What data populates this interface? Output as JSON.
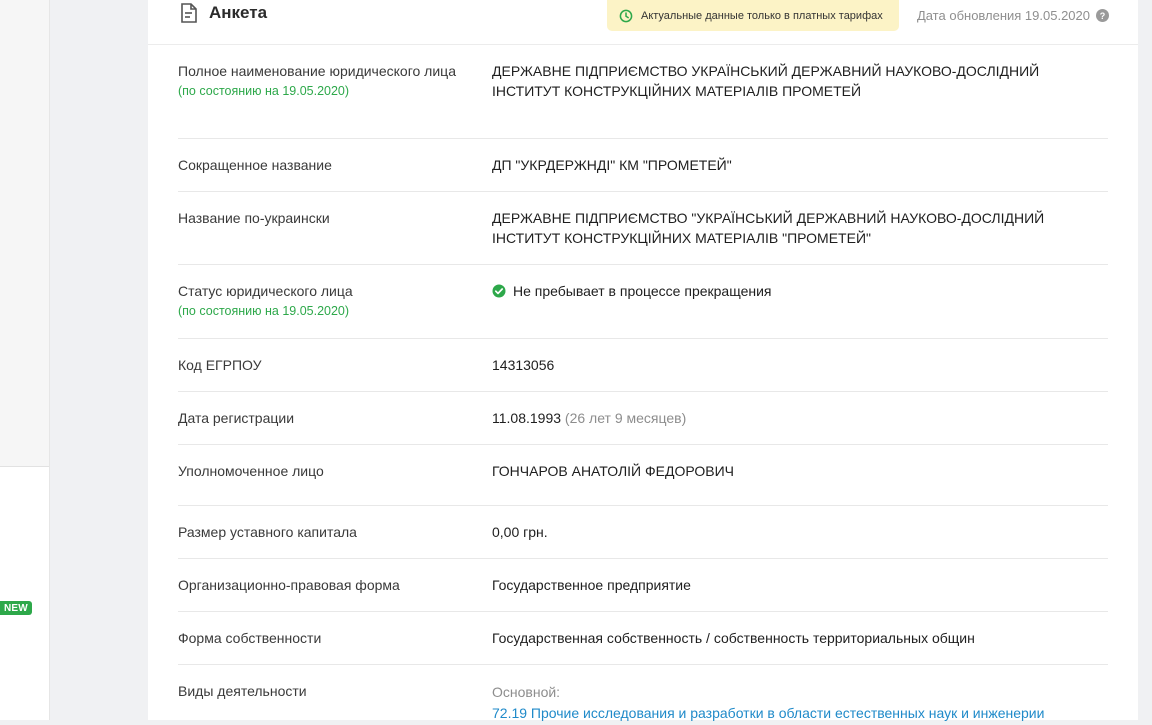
{
  "card": {
    "title": "Анкета",
    "banner_text": "Актуальные данные только в платных тарифах",
    "update_date": "Дата обновления 19.05.2020"
  },
  "sidebar": {
    "new_badge": "NEW"
  },
  "rows": [
    {
      "label": "Полное наименование юридического лица",
      "sublabel": "(по состоянию на 19.05.2020)",
      "value": "ДЕРЖАВНЕ ПІДПРИЄМСТВО УКРАЇНСЬКИЙ ДЕРЖАВНИЙ НАУКОВО-ДОСЛІДНИЙ ІНСТИТУТ КОНСТРУКЦІЙНИХ МАТЕРІАЛІВ ПРОМЕТЕЙ"
    },
    {
      "label": "Сокращенное название",
      "value": "ДП \"УКРДЕРЖНДІ\" КМ \"ПРОМЕТЕЙ\""
    },
    {
      "label": "Название по-украински",
      "value": "ДЕРЖАВНЕ ПІДПРИЄМСТВО \"УКРАЇНСЬКИЙ ДЕРЖАВНИЙ НАУКОВО-ДОСЛІДНИЙ ІНСТИТУТ КОНСТРУКЦІЙНИХ МАТЕРІАЛІВ \"ПРОМЕТЕЙ\""
    },
    {
      "label": "Статус юридического лица",
      "sublabel": "(по состоянию на 19.05.2020)",
      "value": "Не пребывает в процессе прекращения"
    },
    {
      "label": "Код ЕГРПОУ",
      "value": "14313056"
    },
    {
      "label": "Дата регистрации",
      "value": "11.08.1993",
      "value_extra": "(26 лет 9 месяцев)"
    },
    {
      "label": "Уполномоченное лицо",
      "value": "ГОНЧАРОВ АНАТОЛІЙ ФЕДОРОВИЧ"
    },
    {
      "label": "Размер уставного капитала",
      "value": "0,00 грн."
    },
    {
      "label": "Организационно-правовая форма",
      "value": "Государственное предприятие"
    },
    {
      "label": "Форма собственности",
      "value": "Государственная собственность / собственность территориальных общин"
    },
    {
      "label": "Виды деятельности",
      "value_caption": "Основной:",
      "value": "72.19 Прочие исследования и разработки в области естественных наук и инженерии"
    }
  ],
  "colors": {
    "accent_green": "#2da84a",
    "link_blue": "#1f8ac9",
    "banner_bg": "#fcf3c6"
  }
}
